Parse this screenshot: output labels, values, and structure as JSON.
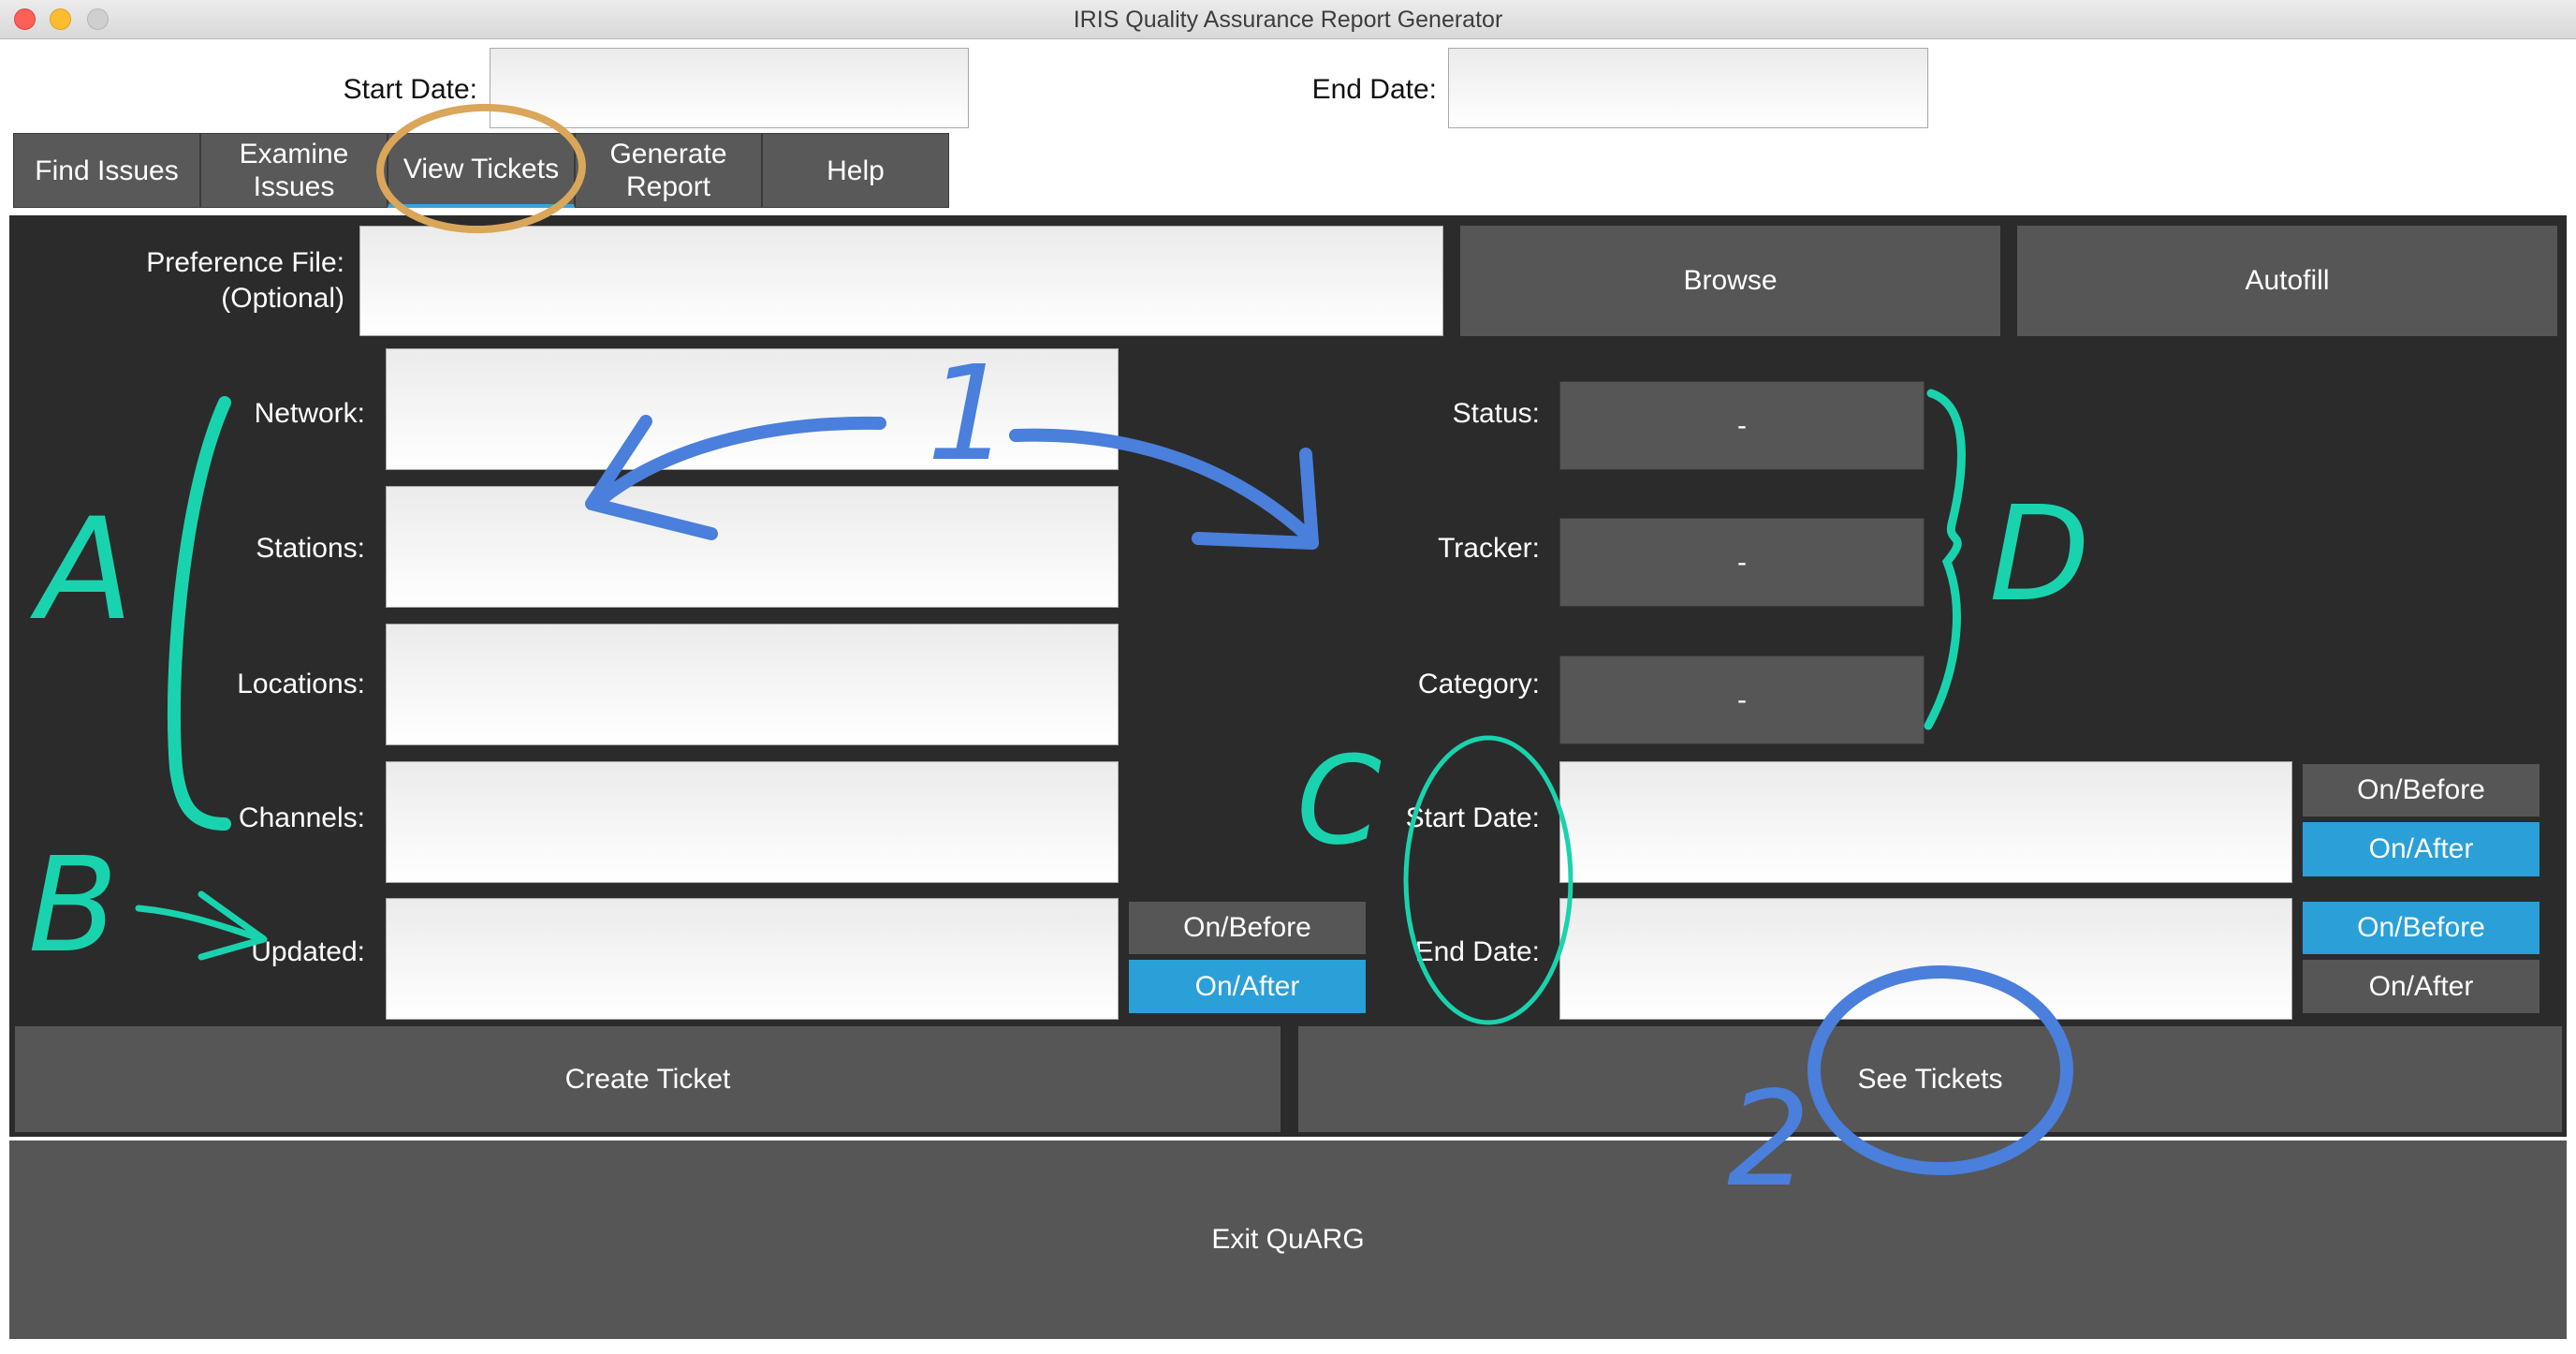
{
  "window": {
    "title": "IRIS Quality Assurance Report Generator"
  },
  "header": {
    "start_date_label": "Start Date:",
    "start_date_value": "",
    "end_date_label": "End Date:",
    "end_date_value": ""
  },
  "tabs": [
    {
      "label": "Find Issues"
    },
    {
      "label": "Examine\nIssues"
    },
    {
      "label": "View Tickets"
    },
    {
      "label": "Generate\nReport"
    },
    {
      "label": "Help"
    }
  ],
  "active_tab": "View Tickets",
  "view_tickets": {
    "preference_file_label": "Preference File:\n(Optional)",
    "preference_file_value": "",
    "browse_label": "Browse",
    "autofill_label": "Autofill",
    "network_label": "Network:",
    "stations_label": "Stations:",
    "locations_label": "Locations:",
    "channels_label": "Channels:",
    "updated_label": "Updated:",
    "updated_toggle": {
      "on_before": "On/Before",
      "on_after": "On/After",
      "selected": "On/After"
    },
    "status_label": "Status:",
    "status_value": "-",
    "tracker_label": "Tracker:",
    "tracker_value": "-",
    "category_label": "Category:",
    "category_value": "-",
    "start_date_label": "Start Date:",
    "start_toggle": {
      "on_before": "On/Before",
      "on_after": "On/After",
      "selected": "On/After"
    },
    "end_date_label": "End Date:",
    "end_toggle": {
      "on_before": "On/Before",
      "on_after": "On/After",
      "selected": "On/Before"
    },
    "create_ticket_label": "Create Ticket",
    "see_tickets_label": "See Tickets"
  },
  "exit_label": "Exit QuARG",
  "annotations": {
    "letter_a": "A",
    "letter_b": "B",
    "letter_c": "C",
    "letter_d": "D",
    "number_1": "1",
    "number_2": "2",
    "teal_color": "#19d3ae",
    "blue_color": "#4a7fdc",
    "gold_color": "#d9a65a"
  },
  "colors": {
    "panel_bg": "#2b2b2b",
    "button_bg": "#565656",
    "accent_blue": "#2a9fd8"
  }
}
